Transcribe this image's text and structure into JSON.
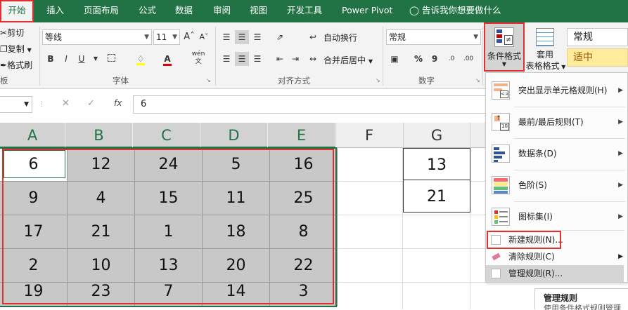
{
  "tabs": [
    "开始",
    "插入",
    "页面布局",
    "公式",
    "数据",
    "审阅",
    "视图",
    "开发工具",
    "Power Pivot"
  ],
  "tell_me": "告诉我你想要做什么",
  "clipboard": {
    "cut": "剪切",
    "copy": "复制",
    "format_painter": "格式刷",
    "group_label": "板"
  },
  "font": {
    "name": "等线",
    "size": "11",
    "bold": "B",
    "italic": "I",
    "underline": "U",
    "group_label": "字体",
    "wen": "wén"
  },
  "alignment": {
    "wrap_text": "自动换行",
    "merge_center": "合并后居中",
    "group_label": "对齐方式"
  },
  "number": {
    "format": "常规",
    "percent": "%",
    "comma": "9",
    "group_label": "数字"
  },
  "styles": {
    "conditional_formatting": "条件格式",
    "format_as_table_1": "套用",
    "format_as_table_2": "表格格式",
    "style_normal": "常规",
    "style_neutral": "适中"
  },
  "formula_bar": {
    "cancel": "✕",
    "enter": "✓",
    "fx": "fx",
    "value": "6"
  },
  "grid": {
    "columns": [
      "A",
      "B",
      "C",
      "D",
      "E",
      "F",
      "G"
    ],
    "rows": [
      [
        "6",
        "12",
        "24",
        "5",
        "16"
      ],
      [
        "9",
        "4",
        "15",
        "11",
        "25"
      ],
      [
        "17",
        "21",
        "1",
        "18",
        "8"
      ],
      [
        "2",
        "10",
        "13",
        "20",
        "22"
      ],
      [
        "19",
        "23",
        "7",
        "14",
        "3"
      ]
    ],
    "g_values": [
      "13",
      "21"
    ]
  },
  "menu": {
    "items": [
      {
        "label": "突出显示单元格规则(H)",
        "icon": "highlight-cells-icon"
      },
      {
        "label": "最前/最后规则(T)",
        "icon": "top-bottom-icon"
      },
      {
        "label": "数据条(D)",
        "icon": "data-bars-icon"
      },
      {
        "label": "色阶(S)",
        "icon": "color-scales-icon"
      },
      {
        "label": "图标集(I)",
        "icon": "icon-sets-icon"
      }
    ],
    "new_rule": "新建规则(N)...",
    "clear_rules": "清除规则(C)",
    "manage_rules": "管理规则(R)..."
  },
  "tooltip": {
    "title": "管理规则",
    "text": "使用条件格式规则管理"
  },
  "colors": {
    "tab_green": "#217346",
    "highlight_red": "#e03030",
    "cell_gray": "#c8c8c8",
    "neutral_fill": "#ffeb9c"
  }
}
